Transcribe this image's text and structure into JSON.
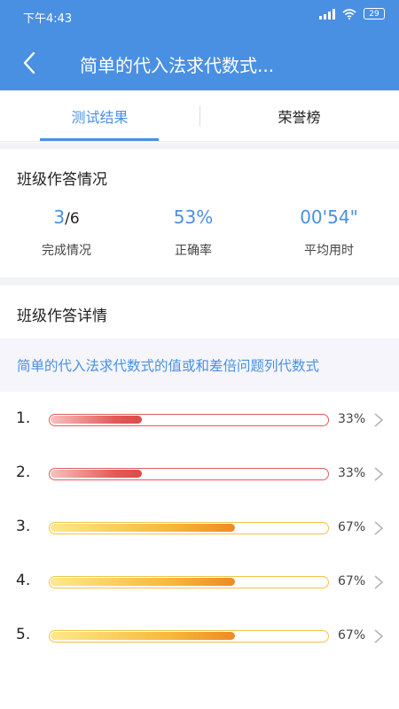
{
  "status_bar": {
    "time": "下午4:43",
    "battery": "29"
  },
  "header": {
    "title": "简单的代入法求代数式..."
  },
  "tabs": [
    {
      "label": "测试结果",
      "active": true
    },
    {
      "label": "荣誉榜",
      "active": false
    }
  ],
  "summary": {
    "title": "班级作答情况",
    "completion": {
      "done": "3",
      "total": "/6",
      "label": "完成情况"
    },
    "accuracy": {
      "value": "53%",
      "label": "正确率"
    },
    "avg_time": {
      "value": "00'54\"",
      "label": "平均用时"
    }
  },
  "details": {
    "title": "班级作答详情",
    "question": "简单的代入法求代数式的值或和差倍问题列代数式",
    "rows": [
      {
        "index": "1.",
        "percent_label": "33%",
        "percent": 33,
        "color": "red"
      },
      {
        "index": "2.",
        "percent_label": "33%",
        "percent": 33,
        "color": "red"
      },
      {
        "index": "3.",
        "percent_label": "67%",
        "percent": 67,
        "color": "orange"
      },
      {
        "index": "4.",
        "percent_label": "67%",
        "percent": 67,
        "color": "orange"
      },
      {
        "index": "5.",
        "percent_label": "67%",
        "percent": 67,
        "color": "orange"
      }
    ]
  },
  "colors": {
    "primary": "#4a90e2",
    "low": "#e35a5a",
    "high": "#f2c24a",
    "page_bg": "#f2f3f7"
  }
}
